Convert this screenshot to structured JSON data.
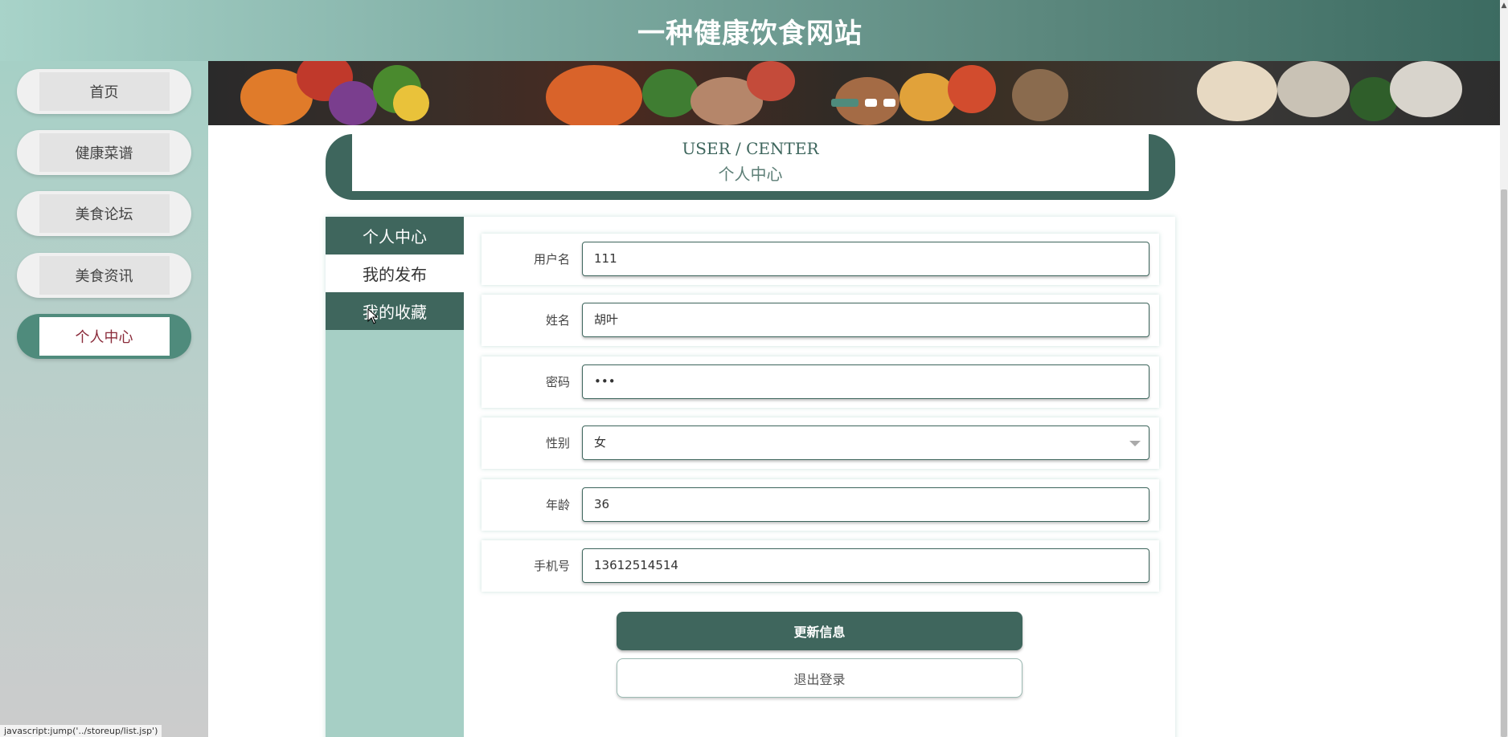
{
  "header": {
    "title": "一种健康饮食网站"
  },
  "sidebar": {
    "items": [
      {
        "label": "首页"
      },
      {
        "label": "健康菜谱"
      },
      {
        "label": "美食论坛"
      },
      {
        "label": "美食资讯"
      },
      {
        "label": "个人中心",
        "active": true
      }
    ]
  },
  "banner": {
    "active_slide": 1,
    "slide_count": 3
  },
  "section": {
    "title_en": "USER / CENTER",
    "title_cn": "个人中心"
  },
  "tabs": [
    {
      "label": "个人中心",
      "active": true
    },
    {
      "label": "我的发布"
    },
    {
      "label": "我的收藏",
      "hovered": true
    }
  ],
  "form": {
    "username": {
      "label": "用户名",
      "value": "111"
    },
    "name": {
      "label": "姓名",
      "value": "胡叶"
    },
    "password": {
      "label": "密码",
      "value": "•••"
    },
    "gender": {
      "label": "性别",
      "value": "女"
    },
    "age": {
      "label": "年龄",
      "value": "36"
    },
    "phone": {
      "label": "手机号",
      "value": "13612514514"
    }
  },
  "buttons": {
    "update": "更新信息",
    "logout": "退出登录"
  },
  "statusbar": {
    "text": "javascript:jump('../storeup/list.jsp')"
  },
  "colors": {
    "primary": "#3f665d",
    "accent": "#4f8b7c",
    "active_text": "#8a2b3a"
  }
}
